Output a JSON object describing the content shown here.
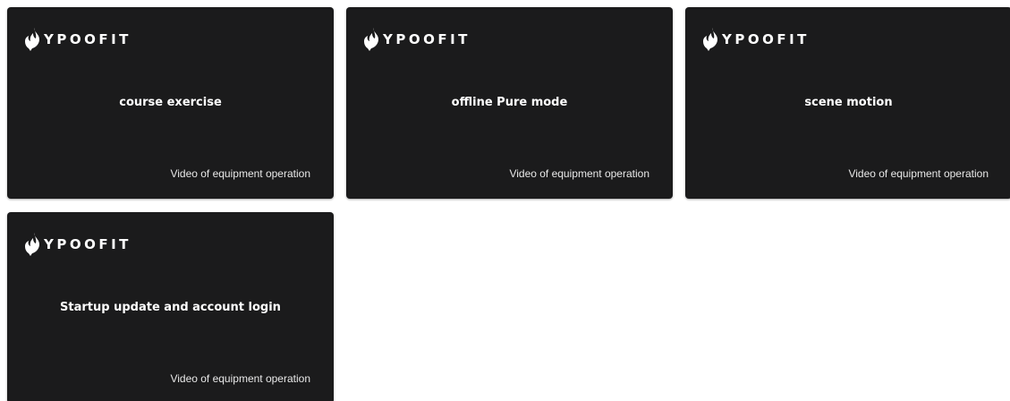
{
  "brand": {
    "name": "YPOOFIT",
    "icon": "flame-logo-icon"
  },
  "colors": {
    "card_background": "#1b1b1c",
    "page_background": "#ffffff",
    "text": "#ffffff"
  },
  "cards": [
    {
      "title": "course exercise",
      "subtitle": "Video of equipment operation"
    },
    {
      "title": "offline Pure mode",
      "subtitle": "Video of equipment operation"
    },
    {
      "title": "scene motion",
      "subtitle": "Video of equipment operation"
    },
    {
      "title": "Startup update and account login",
      "subtitle": "Video of equipment operation"
    }
  ]
}
